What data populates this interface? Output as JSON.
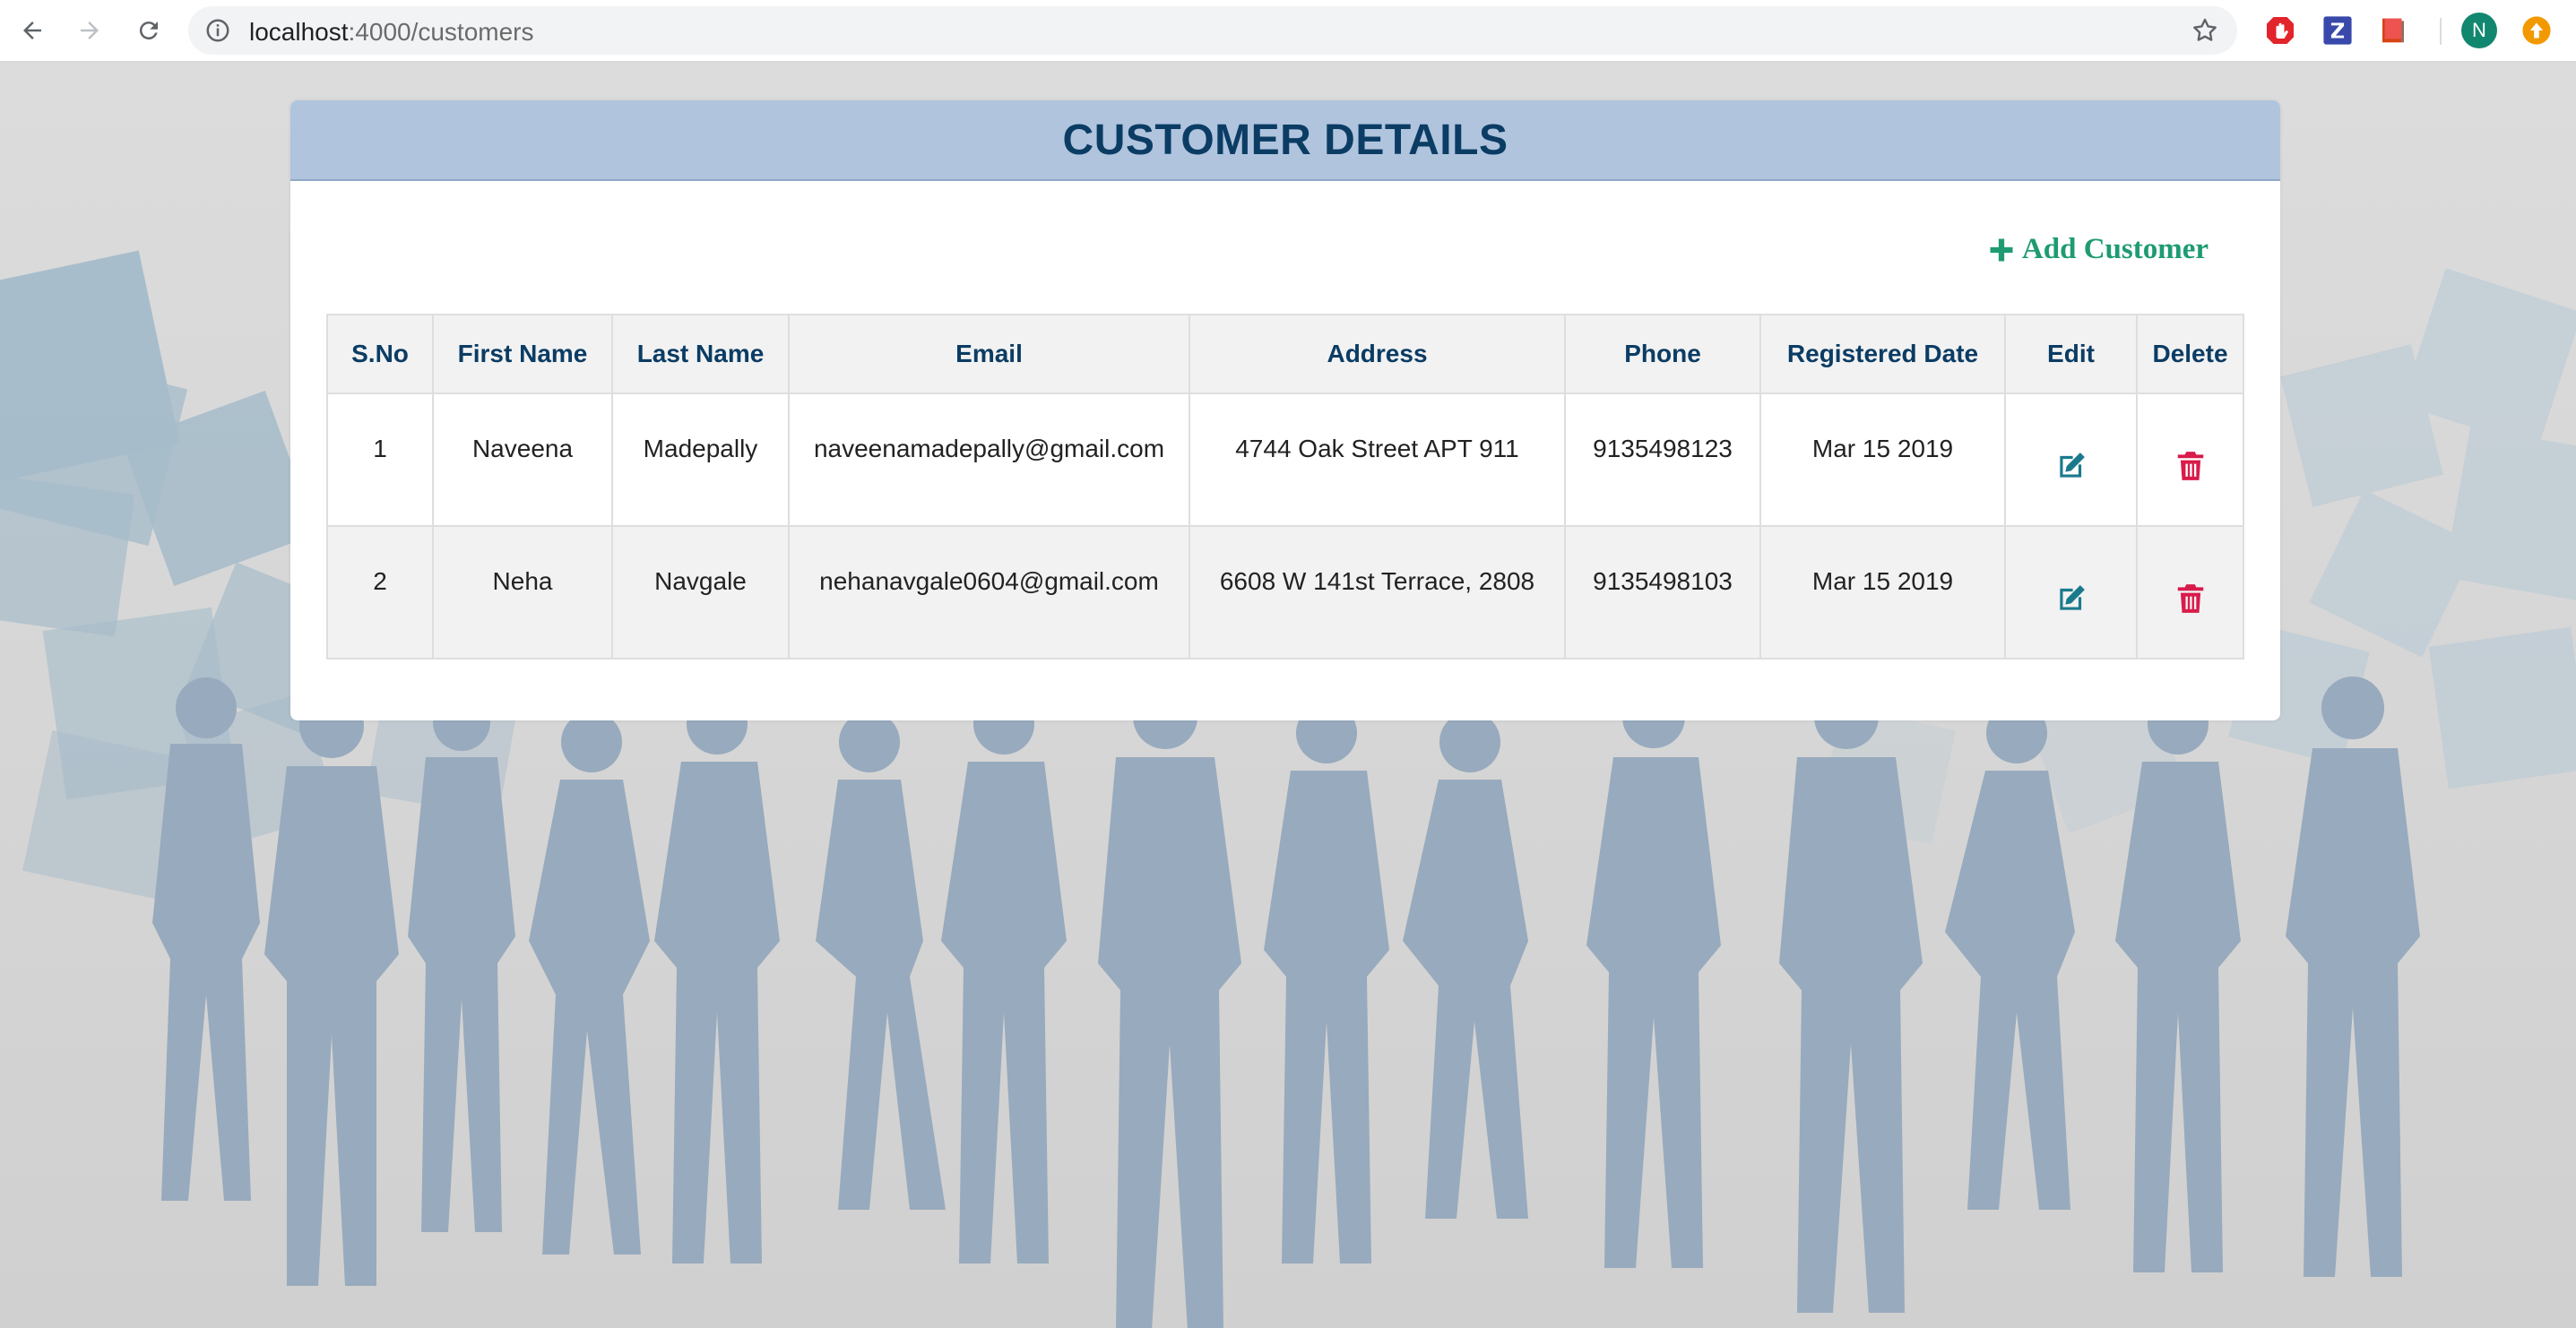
{
  "browser": {
    "url_host": "localhost",
    "url_path": ":4000/customers",
    "profile_initial": "N"
  },
  "page": {
    "title": "CUSTOMER DETAILS",
    "add_customer_label": "Add Customer"
  },
  "table": {
    "headers": [
      "S.No",
      "First Name",
      "Last Name",
      "Email",
      "Address",
      "Phone",
      "Registered Date",
      "Edit",
      "Delete"
    ],
    "rows": [
      {
        "sno": "1",
        "first_name": "Naveena",
        "last_name": "Madepally",
        "email": "naveenamadepally@gmail.com",
        "address": "4744 Oak Street APT 911",
        "phone": "9135498123",
        "registered_date": "Mar 15 2019"
      },
      {
        "sno": "2",
        "first_name": "Neha",
        "last_name": "Navgale",
        "email": "nehanavgale0604@gmail.com",
        "address": "6608 W 141st Terrace, 2808",
        "phone": "9135498103",
        "registered_date": "Mar 15 2019"
      }
    ]
  },
  "colors": {
    "header_bg": "#b0c4de",
    "title_color": "#0b3c64",
    "add_button_color": "#1e9b73",
    "edit_icon_color": "#1a7a8c",
    "delete_icon_color": "#d81b4a"
  },
  "icons": {
    "back": "back-arrow-icon",
    "forward": "forward-arrow-icon",
    "reload": "reload-icon",
    "info": "info-icon",
    "bookmark": "star-icon",
    "add": "plus-icon",
    "edit": "edit-icon",
    "delete": "trash-icon"
  }
}
